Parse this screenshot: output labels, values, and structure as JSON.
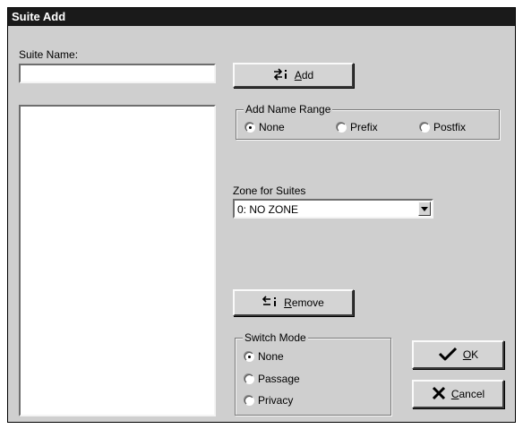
{
  "window": {
    "title": "Suite Add"
  },
  "suite_name": {
    "label": "Suite Name:",
    "value": ""
  },
  "add_button": {
    "label_u": "A",
    "label_rest": "dd"
  },
  "name_range": {
    "title": "Add Name Range",
    "options": [
      "None",
      "Prefix",
      "Postfix"
    ],
    "selected": "None"
  },
  "zone": {
    "label": "Zone for Suites",
    "selected": "0: NO ZONE"
  },
  "remove_button": {
    "label_u": "R",
    "label_rest": "emove"
  },
  "switch_mode": {
    "title": "Switch Mode",
    "options": [
      "None",
      "Passage",
      "Privacy"
    ],
    "selected": "None"
  },
  "ok_button": {
    "label_u": "O",
    "label_rest": "K"
  },
  "cancel_button": {
    "label_u": "C",
    "label_rest": "ancel"
  },
  "colors": {
    "titlebar": "#1a1a1a",
    "dialog": "#cfcfcf"
  }
}
